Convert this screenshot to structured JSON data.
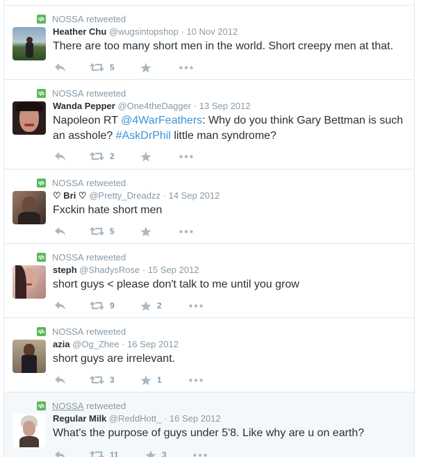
{
  "tweets": [
    {
      "retweeter": "NOSSA",
      "retweet_suffix": "retweeted",
      "fullname": "Heather Chu",
      "username": "@wugsintopshop",
      "date": "10 Nov 2012",
      "text": "There are too many short men in the world. Short creepy men at that.",
      "retweets": "5",
      "favorites": "",
      "avatar_colors": [
        "#6b8aa0",
        "#3a5a2a"
      ]
    },
    {
      "retweeter": "NOSSA",
      "retweet_suffix": "retweeted",
      "fullname": "Wanda Pepper",
      "username": "@One4theDagger",
      "date": "13 Sep 2012",
      "text_parts": [
        "Napoleon RT ",
        "@4WarFeathers",
        ": Why do you think Gary Bettman is such an asshole? ",
        "#AskDrPhil",
        " little man syndrome?"
      ],
      "retweets": "2",
      "favorites": "",
      "avatar_colors": [
        "#2a1a1a",
        "#c88a7a"
      ]
    },
    {
      "retweeter": "NOSSA",
      "retweet_suffix": "retweeted",
      "fullname": "♡ Bri ♡",
      "username": "@Pretty_Dreadzz",
      "date": "14 Sep 2012",
      "text": "Fxckin hate short men",
      "retweets": "5",
      "favorites": "",
      "avatar_colors": [
        "#7a5a4a",
        "#2a2020"
      ]
    },
    {
      "retweeter": "NOSSA",
      "retweet_suffix": "retweeted",
      "fullname": "steph",
      "username": "@ShadysRose",
      "date": "15 Sep 2012",
      "text": "short guys < please don't talk to me until you grow",
      "retweets": "9",
      "favorites": "2",
      "avatar_colors": [
        "#c89a8a",
        "#4a2a2a"
      ]
    },
    {
      "retweeter": "NOSSA",
      "retweet_suffix": "retweeted",
      "fullname": "azia",
      "username": "@Og_Zhee",
      "date": "16 Sep 2012",
      "text": "short guys are irrelevant.",
      "retweets": "3",
      "favorites": "1",
      "avatar_colors": [
        "#8a6a4a",
        "#2a2a2a"
      ]
    },
    {
      "retweeter": "NOSSA",
      "retweet_suffix": "retweeted",
      "fullname": "Regular Milk",
      "username": "@ReddHott_",
      "date": "16 Sep 2012",
      "text": "What's the purpose of guys under 5'8. Like why are u on earth?",
      "retweets": "11",
      "favorites": "3",
      "avatar_colors": [
        "#d8c8b8",
        "#5a3a2a"
      ]
    }
  ],
  "icons": {
    "retweeted_badge": "retweet-badge-icon",
    "reply": "reply-icon",
    "retweet": "retweet-icon",
    "favorite": "star-icon",
    "more": "more-dots-icon"
  },
  "colors": {
    "accent": "#3b94d9",
    "retweet_green": "#5cb85c",
    "muted": "#8899a6",
    "action": "#aab8c2"
  },
  "separator": "·"
}
